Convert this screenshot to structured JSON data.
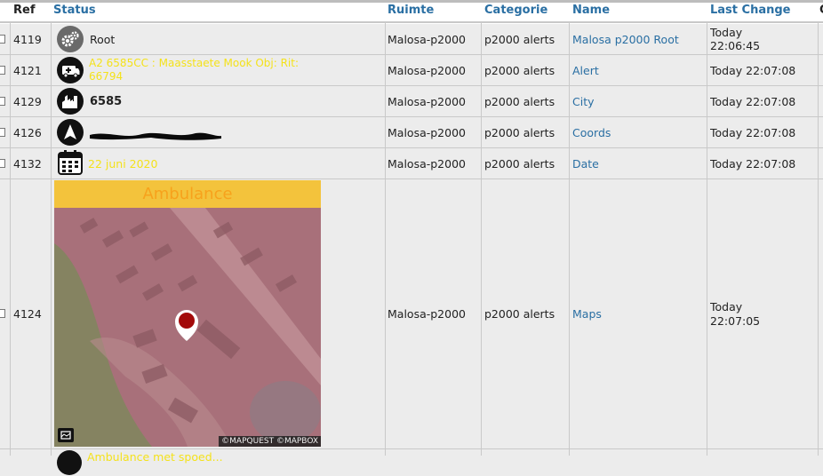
{
  "columns": {
    "ref": "Ref",
    "status": "Status",
    "ruimte": "Ruimte",
    "categorie": "Categorie",
    "name": "Name",
    "last_change": "Last Change",
    "extra": "C"
  },
  "rows": [
    {
      "ref": "4119",
      "status": "Root",
      "ruimte": "Malosa-p2000",
      "categorie": "p2000 alerts",
      "name": "Malosa p2000 Root",
      "lc1": "Today",
      "lc2": "22:06:45",
      "icon": "gears-icon"
    },
    {
      "ref": "4121",
      "status": "A2 6585CC : Maasstaete Mook Obj: Rit: 66794",
      "ruimte": "Malosa-p2000",
      "categorie": "p2000 alerts",
      "name": "Alert",
      "lc": "Today 22:07:08",
      "icon": "ambulance-icon"
    },
    {
      "ref": "4129",
      "status": "6585",
      "ruimte": "Malosa-p2000",
      "categorie": "p2000 alerts",
      "name": "City",
      "lc": "Today 22:07:08",
      "icon": "city-icon"
    },
    {
      "ref": "4126",
      "status": "",
      "ruimte": "Malosa-p2000",
      "categorie": "p2000 alerts",
      "name": "Coords",
      "lc": "Today 22:07:08",
      "icon": "navigation-arrow-icon"
    },
    {
      "ref": "4132",
      "status": "22 juni 2020",
      "ruimte": "Malosa-p2000",
      "categorie": "p2000 alerts",
      "name": "Date",
      "lc": "Today 22:07:08",
      "icon": "calendar-icon"
    },
    {
      "ref": "4124",
      "status": "",
      "ruimte": "Malosa-p2000",
      "categorie": "p2000 alerts",
      "name": "Maps",
      "lc1": "Today",
      "lc2": "22:07:05",
      "icon": "map-icon"
    },
    {
      "status": "Ambulance met spoed... "
    }
  ],
  "map": {
    "banner": "Ambulance",
    "attribution": "©MAPQUEST ©MAPBOX",
    "banner_color": "#f3c33c",
    "tint_color": "#b06a72",
    "marker_color": "#a30a0a"
  }
}
